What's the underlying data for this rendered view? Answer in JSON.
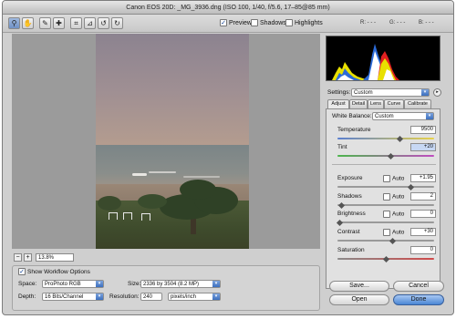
{
  "window": {
    "title": "Canon EOS 20D:  _MG_3936.dng  (ISO 100, 1/40, f/5.6, 17–85@85 mm)"
  },
  "toolbar": {
    "tools": [
      {
        "name": "zoom-tool",
        "icon": "magnifier-icon",
        "glyph": "⚲",
        "active": true
      },
      {
        "name": "hand-tool",
        "icon": "hand-icon",
        "glyph": "✋",
        "active": false
      },
      {
        "name": "white-balance-tool",
        "icon": "eyedropper-icon",
        "glyph": "✎",
        "active": false
      },
      {
        "name": "color-sampler-tool",
        "icon": "color-sampler-icon",
        "glyph": "✚",
        "active": false
      },
      {
        "name": "crop-tool",
        "icon": "crop-icon",
        "glyph": "⌗",
        "active": false
      },
      {
        "name": "straighten-tool",
        "icon": "straighten-icon",
        "glyph": "⊿",
        "active": false
      },
      {
        "name": "rotate-left-tool",
        "icon": "rotate-left-icon",
        "glyph": "↺",
        "active": false
      },
      {
        "name": "rotate-right-tool",
        "icon": "rotate-right-icon",
        "glyph": "↻",
        "active": false
      }
    ],
    "preview": {
      "label": "Preview",
      "checked": true
    },
    "shadows": {
      "label": "Shadows",
      "checked": false
    },
    "highlights": {
      "label": "Highlights",
      "checked": false
    },
    "rgb": {
      "r": "R:  - - -",
      "g": "G:  - - -",
      "b": "B:  - - -"
    }
  },
  "zoom": {
    "minus": "−",
    "plus": "+",
    "value": "13.8%"
  },
  "workflow": {
    "show_label": "Show Workflow Options",
    "show_checked": true,
    "space_label": "Space:",
    "space_value": "ProPhoto RGB",
    "depth_label": "Depth:",
    "depth_value": "16 Bits/Channel",
    "size_label": "Size:",
    "size_value": "2336 by 3504  (8.2 MP)",
    "resolution_label": "Resolution:",
    "resolution_value": "240",
    "resolution_unit": "pixels/inch"
  },
  "settings": {
    "label": "Settings:",
    "value": "Custom"
  },
  "tabs": [
    "Adjust",
    "Detail",
    "Lens",
    "Curve",
    "Calibrate"
  ],
  "adjust": {
    "white_balance_label": "White Balance:",
    "white_balance_value": "Custom",
    "temperature_label": "Temperature",
    "temperature_value": "9500",
    "tint_label": "Tint",
    "tint_value": "+20",
    "exposure_label": "Exposure",
    "exposure_value": "+1.95",
    "shadows_label": "Shadows",
    "shadows_value": "2",
    "brightness_label": "Brightness",
    "brightness_value": "0",
    "contrast_label": "Contrast",
    "contrast_value": "+30",
    "saturation_label": "Saturation",
    "saturation_value": "0",
    "auto_label": "Auto"
  },
  "buttons": {
    "save": "Save...",
    "cancel": "Cancel",
    "open": "Open",
    "done": "Done"
  },
  "colors": {
    "accent": "#4a86d4",
    "window_bg": "#cfcfcf",
    "histogram_bg": "#000000"
  }
}
